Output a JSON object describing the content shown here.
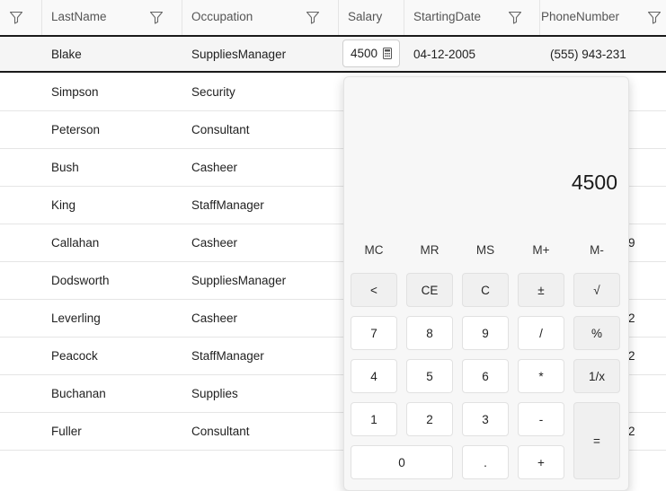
{
  "columns": [
    {
      "label": ""
    },
    {
      "label": "LastName"
    },
    {
      "label": "Occupation"
    },
    {
      "label": "Salary"
    },
    {
      "label": "StartingDate"
    },
    {
      "label": "PhoneNumber"
    }
  ],
  "selected_row": {
    "lastname": "Blake",
    "occupation": "SuppliesManager",
    "salary": "4500",
    "startingdate": "04-12-2005",
    "phone": "(555) 943-231"
  },
  "rows": [
    {
      "lastname": "Simpson",
      "occupation": "Security",
      "phone_tail": ""
    },
    {
      "lastname": "Peterson",
      "occupation": "Consultant",
      "phone_tail": ""
    },
    {
      "lastname": "Bush",
      "occupation": "Casheer",
      "phone_tail": ""
    },
    {
      "lastname": "King",
      "occupation": "StaffManager",
      "phone_tail": ""
    },
    {
      "lastname": "Callahan",
      "occupation": "Casheer",
      "phone_tail": "9"
    },
    {
      "lastname": "Dodsworth",
      "occupation": "SuppliesManager",
      "phone_tail": ""
    },
    {
      "lastname": "Leverling",
      "occupation": "Casheer",
      "phone_tail": "2"
    },
    {
      "lastname": "Peacock",
      "occupation": "StaffManager",
      "phone_tail": "2"
    },
    {
      "lastname": "Buchanan",
      "occupation": "Supplies",
      "phone_tail": ""
    },
    {
      "lastname": "Fuller",
      "occupation": "Consultant",
      "phone_tail": "2"
    }
  ],
  "calculator": {
    "display": "4500",
    "memory": [
      "MC",
      "MR",
      "MS",
      "M+",
      "M-"
    ],
    "keys": {
      "back": "<",
      "ce": "CE",
      "c": "C",
      "sign": "±",
      "sqrt": "√",
      "n7": "7",
      "n8": "8",
      "n9": "9",
      "div": "/",
      "pct": "%",
      "n4": "4",
      "n5": "5",
      "n6": "6",
      "mul": "*",
      "recip": "1/x",
      "n1": "1",
      "n2": "2",
      "n3": "3",
      "sub": "-",
      "eq": "=",
      "n0": "0",
      "dot": ".",
      "add": "+"
    }
  }
}
